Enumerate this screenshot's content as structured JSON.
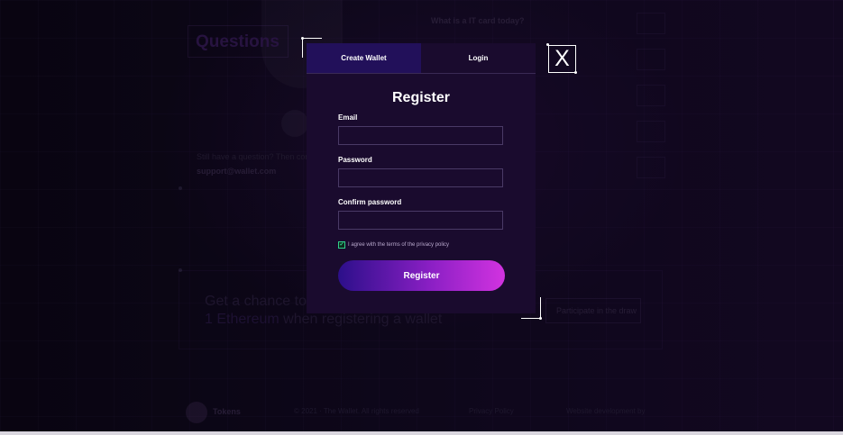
{
  "background": {
    "questions_title": "Questions",
    "faq_question": "What is a IT card today?",
    "contact_text": "Still have a question? Then contact us",
    "contact_email": "support@wallet.com",
    "promo_line1": "Get a chance to win",
    "promo_line2_accent": "1 Ethereum",
    "promo_line2_rest": "when registering a wallet",
    "participate_label": "Participate in the draw",
    "footer_brand": "Tokens",
    "footer_mid": "© 2021 · The Wallet. All rights reserved",
    "footer_policy": "Privacy Policy",
    "footer_dev": "Website development by"
  },
  "modal": {
    "tabs": [
      {
        "label": "Create Wallet",
        "active": true
      },
      {
        "label": "Login",
        "active": false
      }
    ],
    "title": "Register",
    "fields": [
      {
        "label": "Email",
        "value": "",
        "placeholder": ""
      },
      {
        "label": "Password",
        "value": "",
        "placeholder": ""
      },
      {
        "label": "Confirm password",
        "value": "",
        "placeholder": ""
      }
    ],
    "agree_checked": true,
    "agree_text": "I agree with the terms of the privacy policy",
    "register_button": "Register",
    "close_label": "X"
  },
  "colors": {
    "modal_bg": "#1a0b2e",
    "active_tab": "#22105a",
    "button_gradient_start": "#2c0f8a",
    "button_gradient_end": "#d233e0",
    "checkbox_accent": "#2fd08a"
  },
  "icons": {
    "close": "close-icon",
    "check": "check-icon"
  }
}
